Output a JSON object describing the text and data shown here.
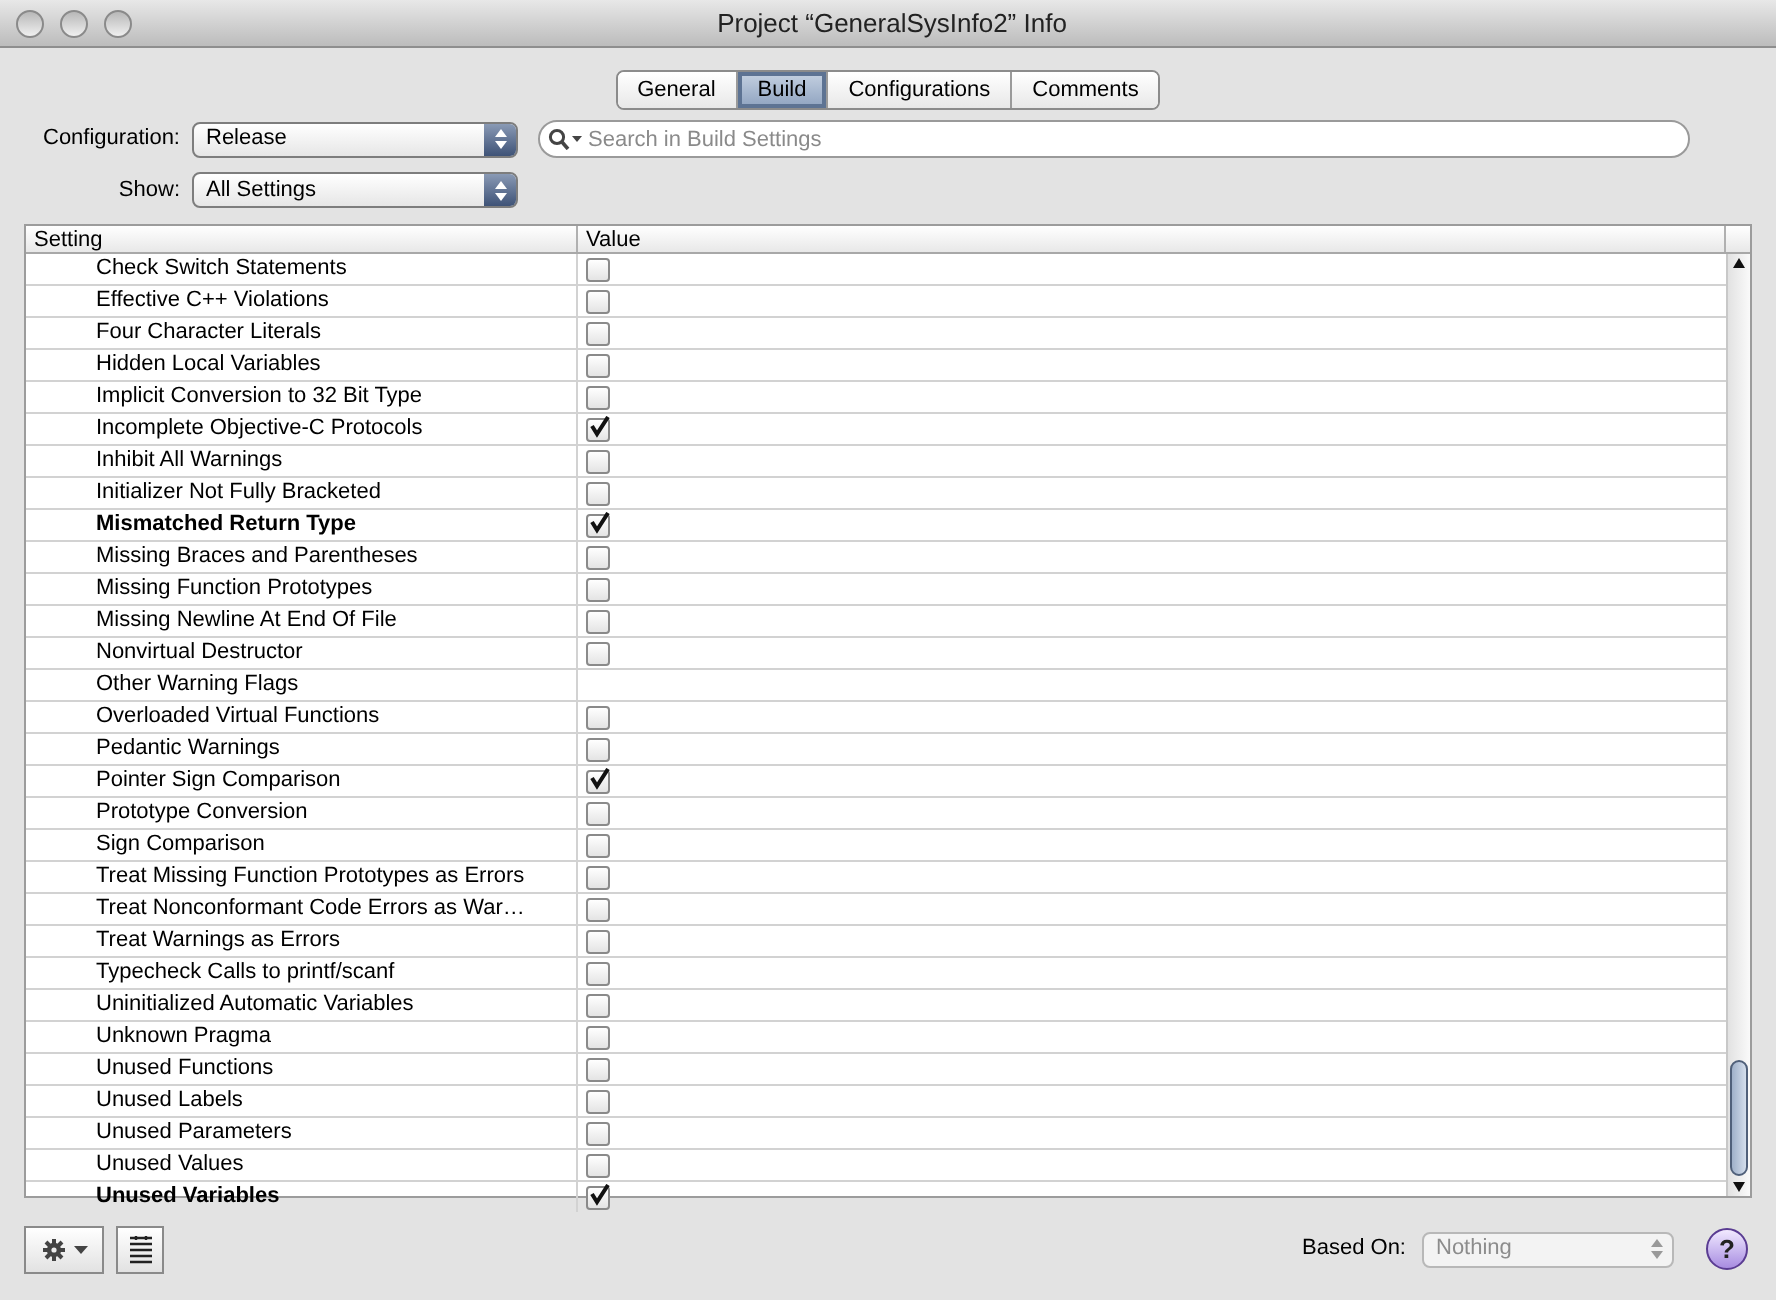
{
  "window": {
    "title": "Project “GeneralSysInfo2” Info"
  },
  "tabs": [
    {
      "label": "General",
      "selected": false
    },
    {
      "label": "Build",
      "selected": true
    },
    {
      "label": "Configurations",
      "selected": false
    },
    {
      "label": "Comments",
      "selected": false
    }
  ],
  "configuration": {
    "label": "Configuration:",
    "value": "Release"
  },
  "show": {
    "label": "Show:",
    "value": "All Settings"
  },
  "search": {
    "placeholder": "Search in Build Settings"
  },
  "table": {
    "columns": [
      "Setting",
      "Value"
    ],
    "rows": [
      {
        "setting": "Check Switch Statements",
        "kind": "checkbox",
        "checked": false,
        "modified": false
      },
      {
        "setting": "Effective C++ Violations",
        "kind": "checkbox",
        "checked": false,
        "modified": false
      },
      {
        "setting": "Four Character Literals",
        "kind": "checkbox",
        "checked": false,
        "modified": false
      },
      {
        "setting": "Hidden Local Variables",
        "kind": "checkbox",
        "checked": false,
        "modified": false
      },
      {
        "setting": "Implicit Conversion to 32 Bit Type",
        "kind": "checkbox",
        "checked": false,
        "modified": false
      },
      {
        "setting": "Incomplete Objective-C Protocols",
        "kind": "checkbox",
        "checked": true,
        "modified": false
      },
      {
        "setting": "Inhibit All Warnings",
        "kind": "checkbox",
        "checked": false,
        "modified": false
      },
      {
        "setting": "Initializer Not Fully Bracketed",
        "kind": "checkbox",
        "checked": false,
        "modified": false
      },
      {
        "setting": "Mismatched Return Type",
        "kind": "checkbox",
        "checked": true,
        "modified": true
      },
      {
        "setting": "Missing Braces and Parentheses",
        "kind": "checkbox",
        "checked": false,
        "modified": false
      },
      {
        "setting": "Missing Function Prototypes",
        "kind": "checkbox",
        "checked": false,
        "modified": false
      },
      {
        "setting": "Missing Newline At End Of File",
        "kind": "checkbox",
        "checked": false,
        "modified": false
      },
      {
        "setting": "Nonvirtual Destructor",
        "kind": "checkbox",
        "checked": false,
        "modified": false
      },
      {
        "setting": "Other Warning Flags",
        "kind": "text",
        "modified": false
      },
      {
        "setting": "Overloaded Virtual Functions",
        "kind": "checkbox",
        "checked": false,
        "modified": false
      },
      {
        "setting": "Pedantic Warnings",
        "kind": "checkbox",
        "checked": false,
        "modified": false
      },
      {
        "setting": "Pointer Sign Comparison",
        "kind": "checkbox",
        "checked": true,
        "modified": false
      },
      {
        "setting": "Prototype Conversion",
        "kind": "checkbox",
        "checked": false,
        "modified": false
      },
      {
        "setting": "Sign Comparison",
        "kind": "checkbox",
        "checked": false,
        "modified": false
      },
      {
        "setting": "Treat Missing Function Prototypes as Errors",
        "kind": "checkbox",
        "checked": false,
        "modified": false
      },
      {
        "setting": "Treat Nonconformant Code Errors as War…",
        "kind": "checkbox",
        "checked": false,
        "modified": false
      },
      {
        "setting": "Treat Warnings as Errors",
        "kind": "checkbox",
        "checked": false,
        "modified": false
      },
      {
        "setting": "Typecheck Calls to printf/scanf",
        "kind": "checkbox",
        "checked": false,
        "modified": false
      },
      {
        "setting": "Uninitialized Automatic Variables",
        "kind": "checkbox",
        "checked": false,
        "modified": false
      },
      {
        "setting": "Unknown Pragma",
        "kind": "checkbox",
        "checked": false,
        "modified": false
      },
      {
        "setting": "Unused Functions",
        "kind": "checkbox",
        "checked": false,
        "modified": false
      },
      {
        "setting": "Unused Labels",
        "kind": "checkbox",
        "checked": false,
        "modified": false
      },
      {
        "setting": "Unused Parameters",
        "kind": "checkbox",
        "checked": false,
        "modified": false
      },
      {
        "setting": "Unused Values",
        "kind": "checkbox",
        "checked": false,
        "modified": false
      },
      {
        "setting": "Unused Variables",
        "kind": "checkbox",
        "checked": true,
        "modified": true
      }
    ]
  },
  "based_on": {
    "label": "Based On:",
    "value": "Nothing",
    "disabled": true
  },
  "help": {
    "label": "?"
  }
}
